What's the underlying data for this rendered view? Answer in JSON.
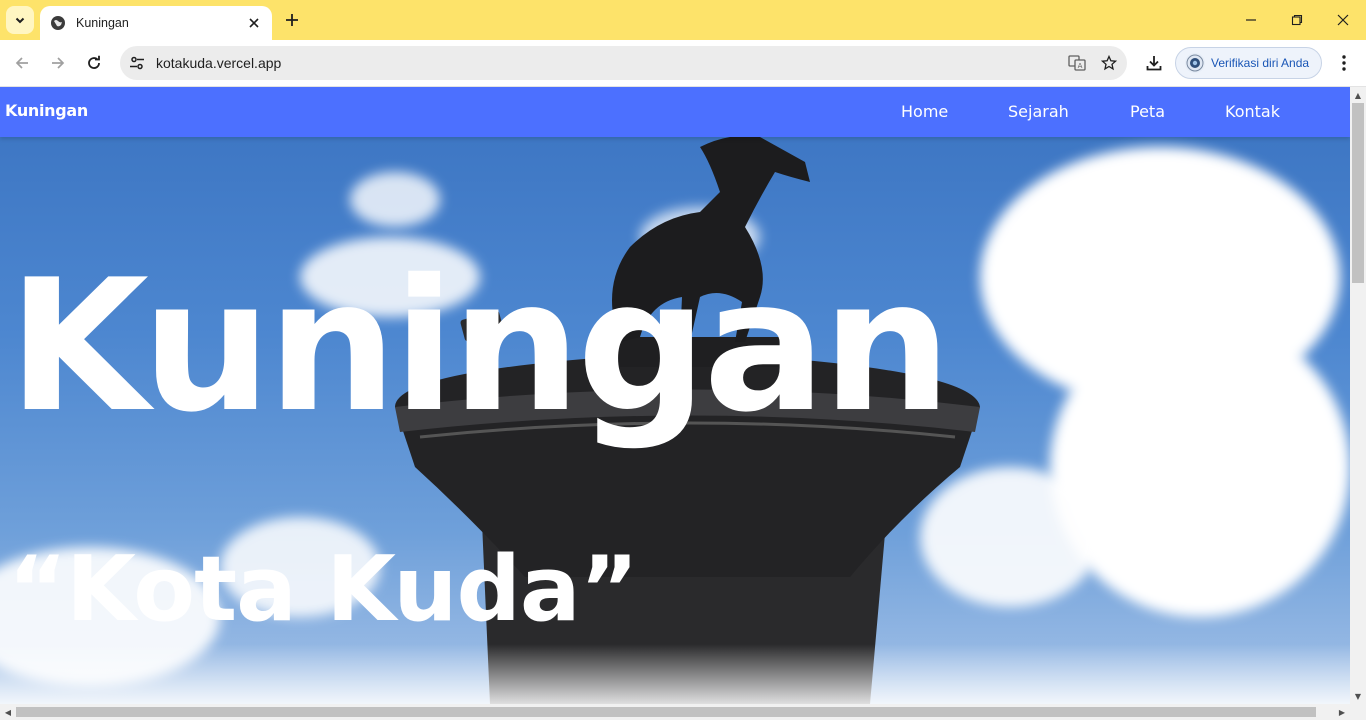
{
  "browser": {
    "tab": {
      "title": "Kuningan",
      "favicon": "globe-icon"
    },
    "address_bar": {
      "url": "kotakuda.vercel.app"
    },
    "profile": {
      "label": "Verifikasi diri Anda"
    },
    "icons": {
      "tab_search": "chevron-down-icon",
      "tab_close": "close-icon",
      "new_tab": "plus-icon",
      "back": "arrow-left-icon",
      "forward": "arrow-right-icon",
      "reload": "reload-icon",
      "site_info": "tune-icon",
      "translate": "translate-icon",
      "bookmark": "star-icon",
      "download": "download-icon",
      "menu": "kebab-menu-icon",
      "minimize": "minimize-icon",
      "restore": "restore-icon",
      "close_window": "close-icon"
    }
  },
  "site": {
    "brand": "Kuningan",
    "nav": [
      {
        "label": "Home"
      },
      {
        "label": "Sejarah"
      },
      {
        "label": "Peta"
      },
      {
        "label": "Kontak"
      }
    ],
    "hero": {
      "title": "Kuningan",
      "subtitle": "“Kota Kuda”",
      "image": "horse-statue-monument"
    }
  },
  "colors": {
    "tabstrip": "#fde36a",
    "navbar": "#4c70ff",
    "text_on_hero": "#ffffff",
    "sky": "#4d87d0"
  }
}
